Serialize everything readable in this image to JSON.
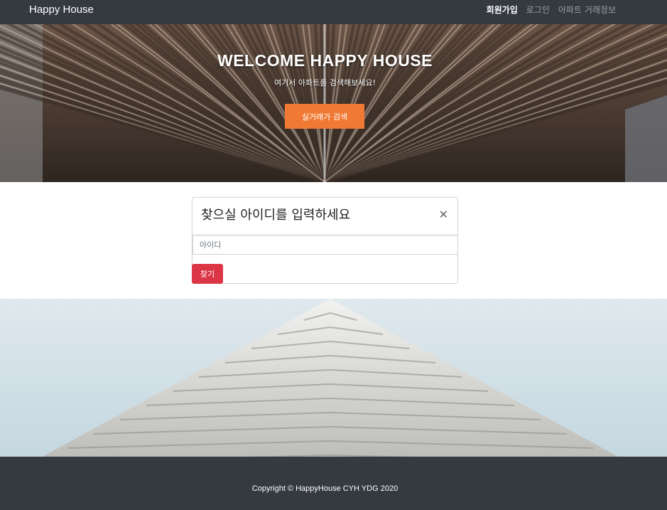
{
  "navbar": {
    "brand": "Happy House",
    "links": [
      {
        "label": "회원가입",
        "active": true
      },
      {
        "label": "로그인",
        "active": false
      },
      {
        "label": "아파트 거래정보",
        "active": false
      }
    ]
  },
  "hero": {
    "title": "WELCOME HAPPY HOUSE",
    "subtitle": "여기서 아파트를 검색해보세요!",
    "button_label": "실거래가 검색",
    "button_color": "#f07a33"
  },
  "find_id_card": {
    "title": "찾으실 아이디를 입력하세요",
    "close_icon": "close-icon",
    "input_placeholder": "아이디",
    "input_value": "",
    "button_label": "찾기",
    "button_color": "#dc3545"
  },
  "footer": {
    "copyright": "Copyright © HappyHouse CYH YDG 2020"
  },
  "colors": {
    "navbar_bg": "#343a40",
    "footer_bg": "#343a40"
  }
}
